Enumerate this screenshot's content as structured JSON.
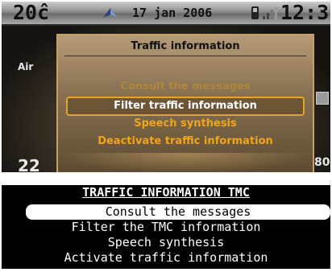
{
  "status_bar": {
    "temperature": "20ĉ",
    "date": "17 jan 2006",
    "clock": "12:3"
  },
  "background": {
    "left_top": "Air",
    "left_bottom": "22",
    "right_bottom": "80"
  },
  "color_dialog": {
    "title": "Traffic information",
    "options": [
      {
        "label": "Consult the messages",
        "state": "disabled"
      },
      {
        "label": "Filter traffic information",
        "state": "selected"
      },
      {
        "label": "Speech synthesis",
        "state": "normal"
      },
      {
        "label": "Deactivate traffic information",
        "state": "normal"
      }
    ]
  },
  "mono_menu": {
    "title": "TRAFFIC INFORMATION TMC",
    "options": [
      {
        "label": "Consult the messages",
        "state": "selected"
      },
      {
        "label": "Filter the TMC information",
        "state": "normal"
      },
      {
        "label": "Speech synthesis",
        "state": "normal"
      },
      {
        "label": "Activate traffic information",
        "state": "normal"
      }
    ]
  },
  "colors": {
    "accent": "#f0a51b",
    "dialog_border": "#c6a165",
    "selection_border": "#e4a32e"
  },
  "icons": [
    "navigation-icon",
    "phone-icon",
    "signal-strength-icon"
  ]
}
